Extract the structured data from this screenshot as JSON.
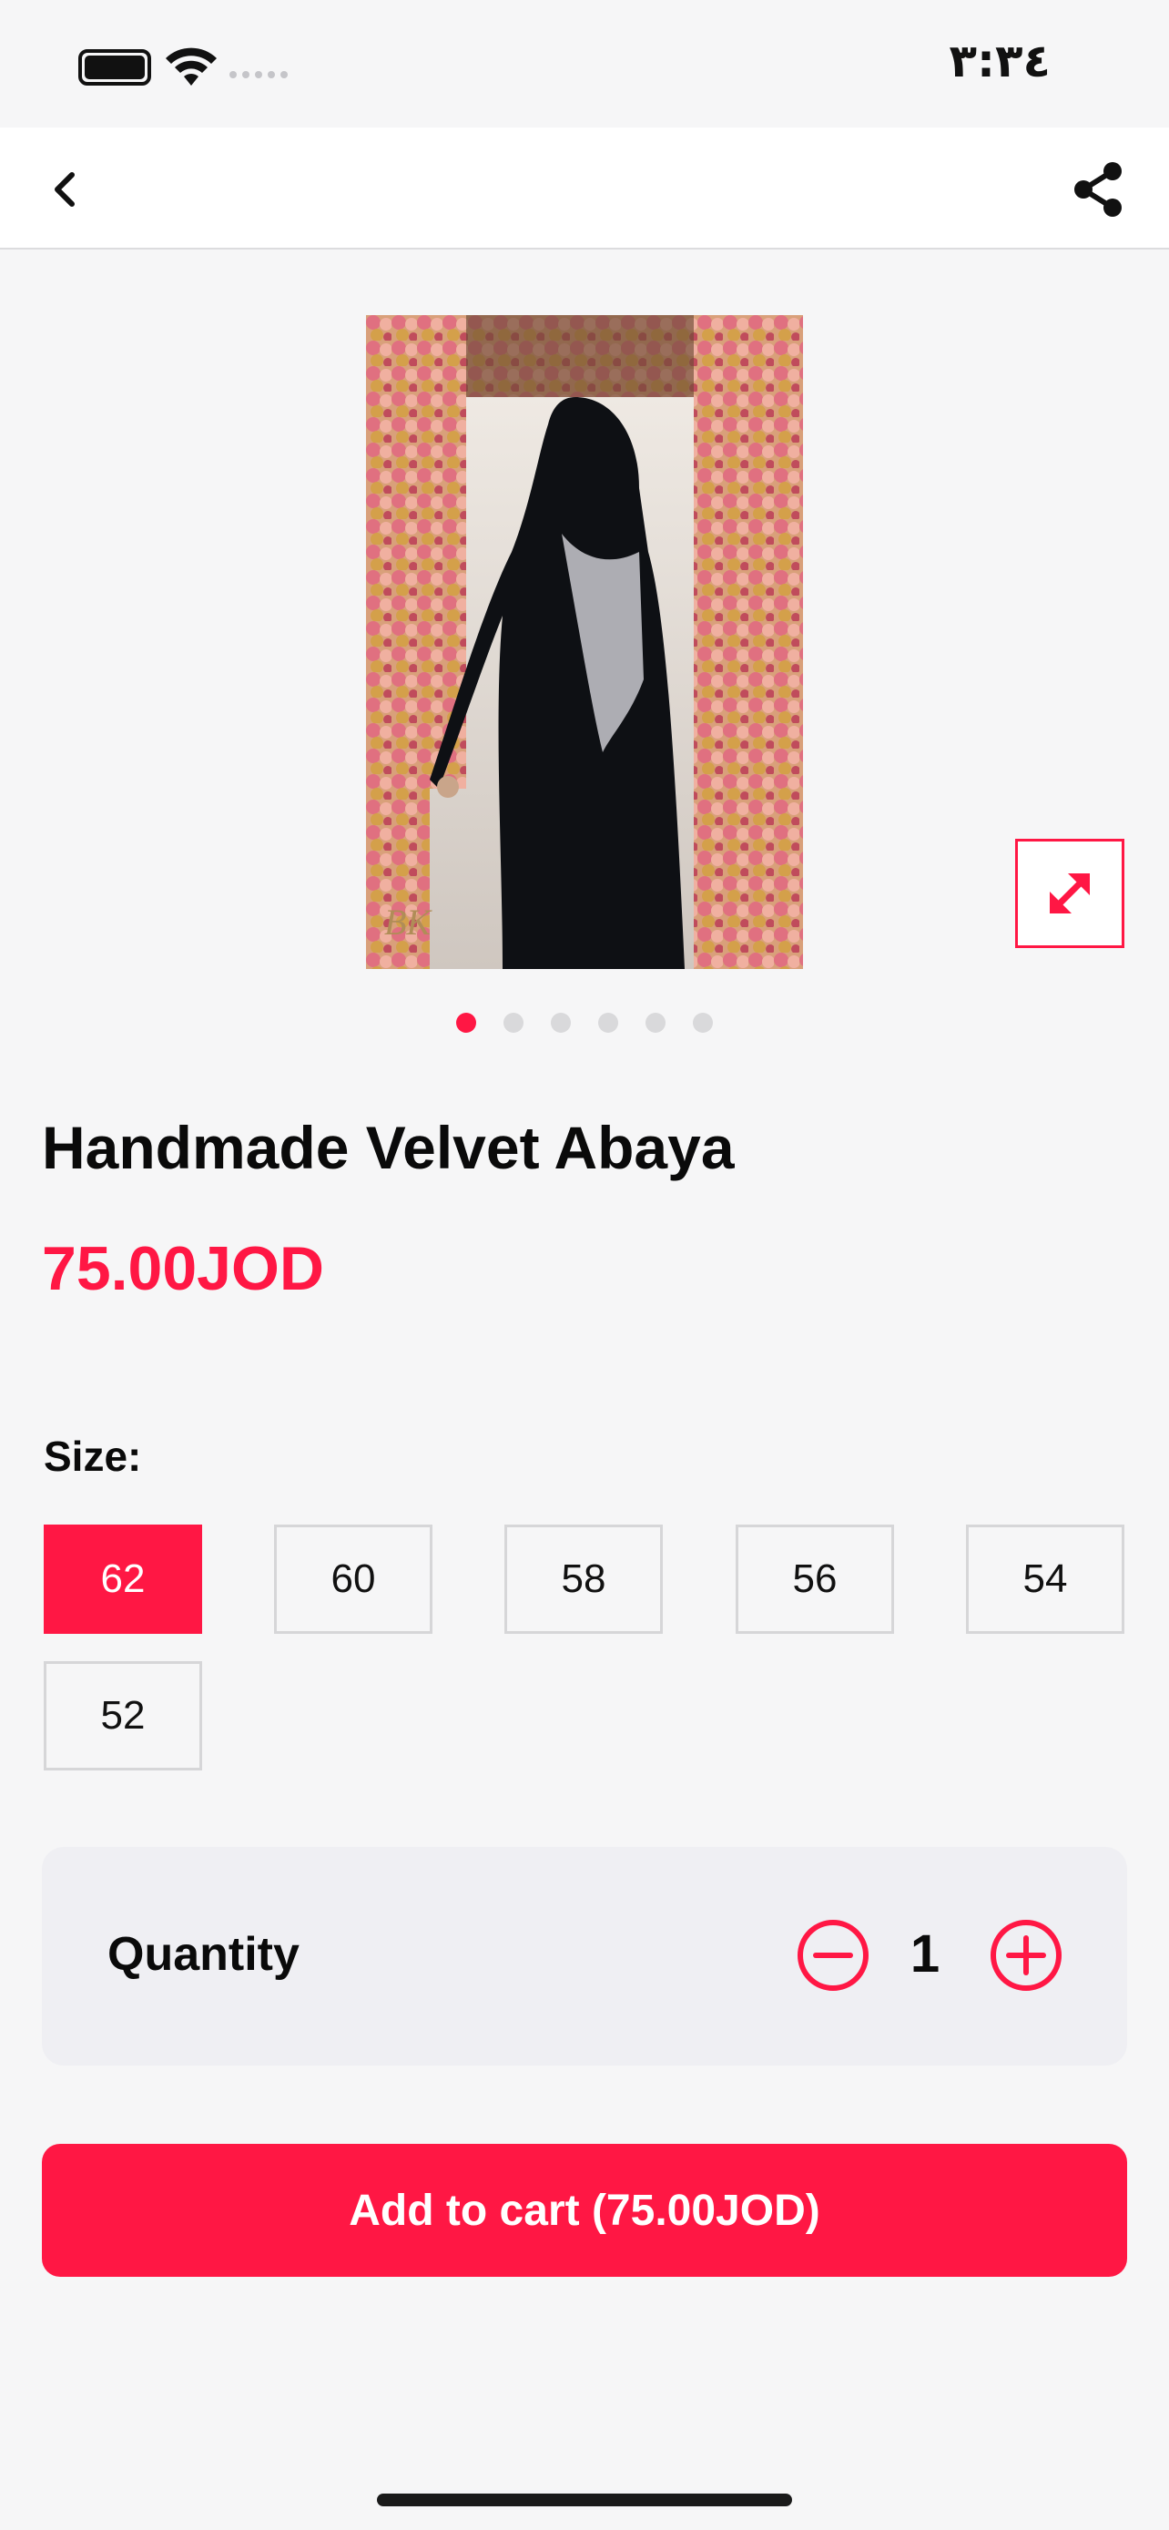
{
  "status_bar": {
    "time": "٣:٣٤",
    "battery_icon": "battery-icon",
    "wifi_icon": "wifi-icon"
  },
  "nav": {
    "back_icon": "chevron-left-icon",
    "share_icon": "share-icon"
  },
  "gallery": {
    "image_count": 6,
    "active_index": 0,
    "expand_icon": "expand-arrows-icon",
    "image_watermark": "kashkha"
  },
  "product": {
    "title": "Handmade Velvet Abaya",
    "price": "75.00JOD"
  },
  "sizes": {
    "label": "Size:",
    "options": [
      "62",
      "60",
      "58",
      "56",
      "54",
      "52"
    ],
    "selected": "62"
  },
  "quantity": {
    "label": "Quantity",
    "value": "1",
    "minus_icon": "minus-circle-icon",
    "plus_icon": "plus-circle-icon"
  },
  "cart": {
    "button_label": "Add to cart (75.00JOD)"
  },
  "colors": {
    "accent": "#ff1744",
    "background": "#f6f6f7",
    "card": "#efeff3"
  }
}
